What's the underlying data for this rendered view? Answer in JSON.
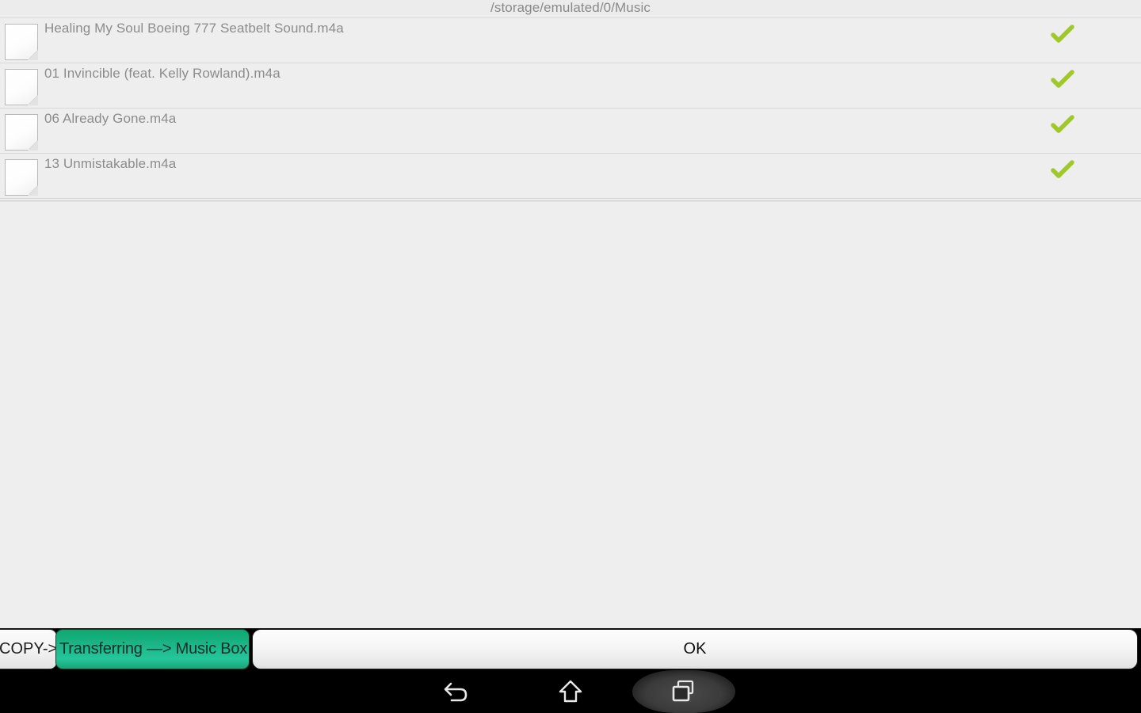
{
  "path_bar": {
    "current_path": "/storage/emulated/0/Music"
  },
  "file_list": {
    "items": [
      {
        "name": "Healing My Soul Boeing 777 Seatbelt Sound.m4a",
        "icon": "document-icon",
        "selected_icon": "check-icon",
        "selected": true
      },
      {
        "name": "01 Invincible (feat. Kelly Rowland).m4a",
        "icon": "document-icon",
        "selected_icon": "check-icon",
        "selected": true
      },
      {
        "name": "06 Already Gone.m4a",
        "icon": "document-icon",
        "selected_icon": "check-icon",
        "selected": true
      },
      {
        "name": "13 Unmistakable.m4a",
        "icon": "document-icon",
        "selected_icon": "check-icon",
        "selected": true
      }
    ]
  },
  "button_bar": {
    "copy_label": "COPY->",
    "transfer_label": "Transferring —> Music Box",
    "ok_label": "OK"
  },
  "nav_bar": {
    "back_icon": "back-arrow-icon",
    "home_icon": "home-icon",
    "recents_icon": "recent-apps-icon",
    "recents_active": true
  },
  "colors": {
    "background": "#eeeeee",
    "row_text": "#8c8c8c",
    "path_text": "#8a8a8a",
    "check_green": "#9fc82a",
    "transfer_button_green": "#1ab486",
    "nav_bar_background": "#000000"
  }
}
